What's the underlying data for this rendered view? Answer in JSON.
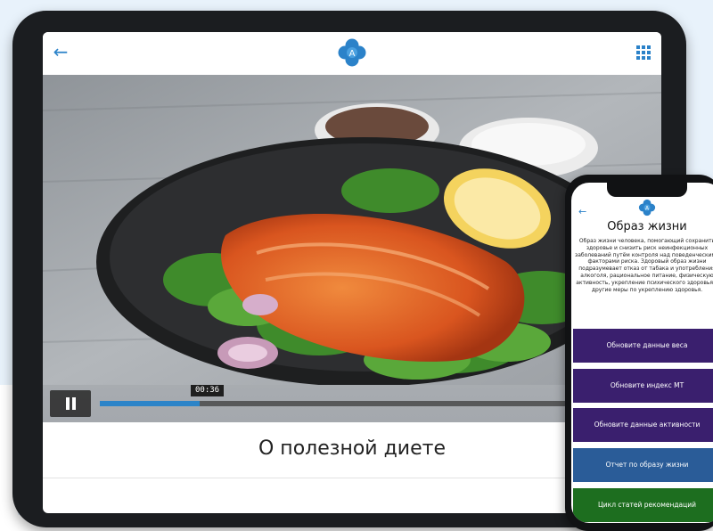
{
  "tablet": {
    "header": {
      "back_icon": "arrow-left-icon",
      "logo": "app-logo-icon",
      "logo_letter": "A",
      "menu_icon": "grid-icon"
    },
    "video": {
      "content": "food-photo (salmon with salad)",
      "current_time": "00:36",
      "progress": 0.18
    },
    "caption": "О полезной диете"
  },
  "phone": {
    "header": {
      "back_icon": "arrow-left-icon",
      "logo": "app-logo-icon",
      "logo_letter": "A"
    },
    "title": "Образ жизни",
    "body_text": "Образ жизни человека, помогающий сохранить здоровье и снизить риск неинфекционных заболеваний путём контроля над поведенческими факторами риска. Здоровый образ жизни подразумевает отказ от табака и употребления алкоголя, рациональное питание, физическую активность, укрепление психического здоровья и другие меры по укреплению здоровья.",
    "buttons": [
      "Обновите данные веса",
      "Обновите индекс МТ",
      "Обновите данные активности",
      "Отчет по образу жизни",
      "Цикл статей рекомендаций"
    ]
  },
  "colors": {
    "accent_blue": "#2b82c9",
    "purple_button": "#3a1f6e",
    "blue_button": "#2a5c98",
    "green_button": "#1d6e1f"
  }
}
